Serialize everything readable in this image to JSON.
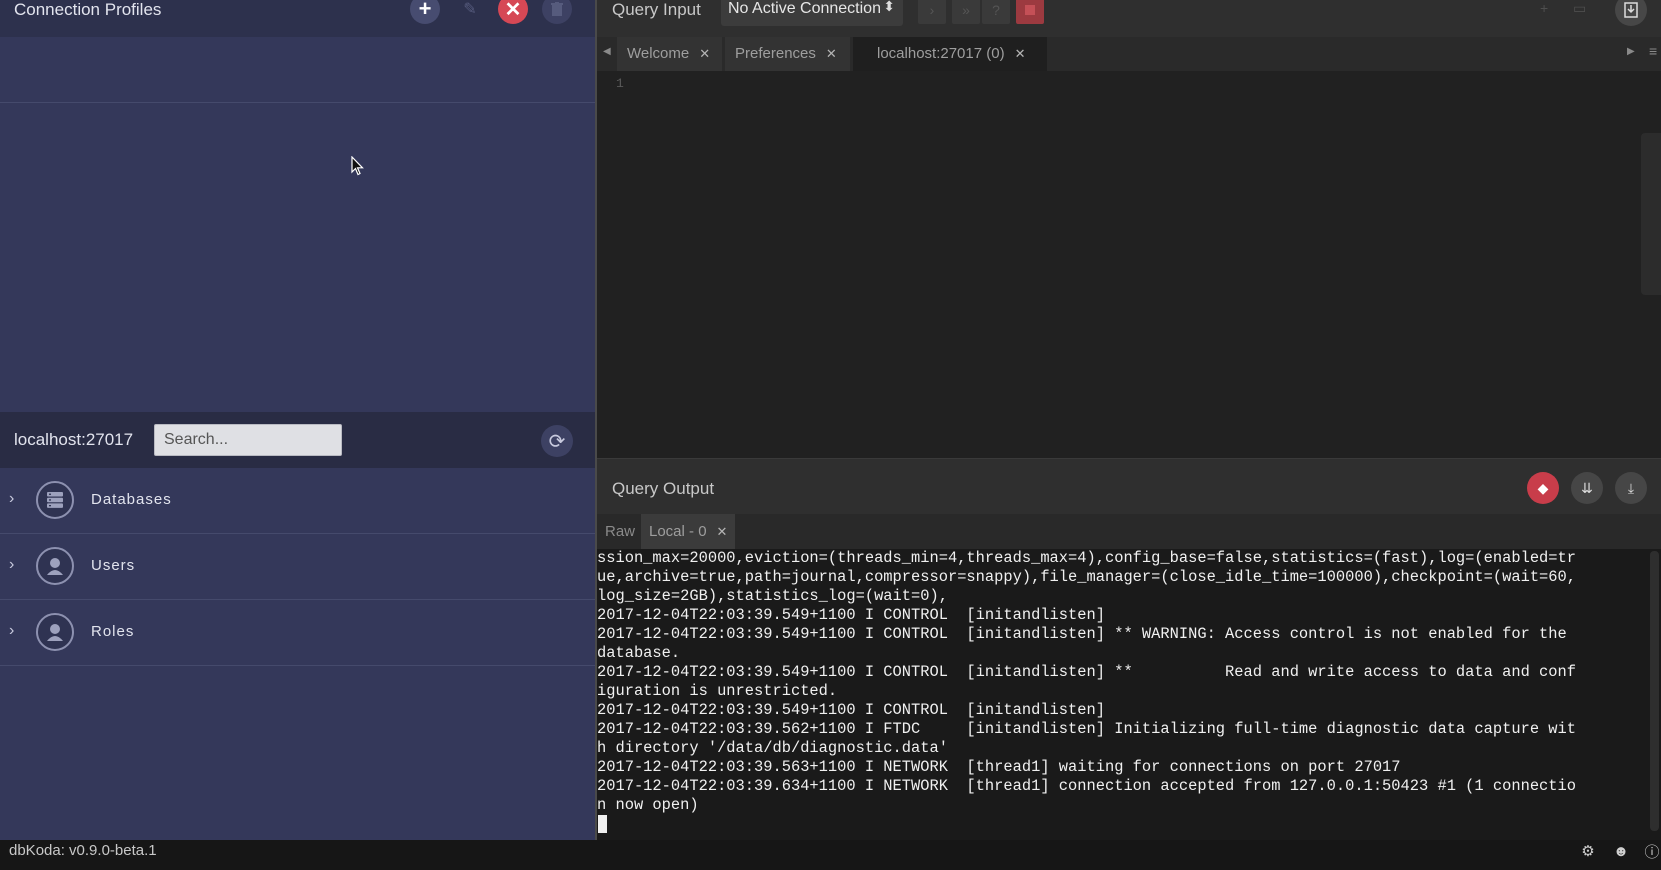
{
  "left_panel": {
    "title": "Connection Profiles",
    "toolbar": {
      "add_glyph": "+",
      "edit_glyph": "✎",
      "close_glyph": "✕",
      "trash_glyph": "🗑"
    },
    "connection_label": "localhost:27017",
    "search_placeholder": "Search...",
    "refresh_glyph": "⟳",
    "tree": [
      {
        "label": "Databases",
        "icon": "database-icon"
      },
      {
        "label": "Users",
        "icon": "user-icon"
      },
      {
        "label": "Roles",
        "icon": "roles-icon"
      }
    ]
  },
  "query_input": {
    "title": "Query Input",
    "connection_select": "No Active Connection",
    "select_arrows": "⬍",
    "tabs": [
      {
        "label": "Welcome",
        "close": "✕"
      },
      {
        "label": "Preferences",
        "close": "✕"
      },
      {
        "label": "localhost:27017 (0)",
        "close": "✕"
      }
    ],
    "line_number": "1"
  },
  "query_output": {
    "title": "Query Output",
    "tabs": [
      {
        "label": "Raw"
      },
      {
        "label": "Local - 0",
        "close": "✕"
      }
    ],
    "log": "ssion_max=20000,eviction=(threads_min=4,threads_max=4),config_base=false,statistics=(fast),log=(enabled=tr\nue,archive=true,path=journal,compressor=snappy),file_manager=(close_idle_time=100000),checkpoint=(wait=60,\nlog_size=2GB),statistics_log=(wait=0),\n2017-12-04T22:03:39.549+1100 I CONTROL  [initandlisten]\n2017-12-04T22:03:39.549+1100 I CONTROL  [initandlisten] ** WARNING: Access control is not enabled for the\ndatabase.\n2017-12-04T22:03:39.549+1100 I CONTROL  [initandlisten] **          Read and write access to data and conf\niguration is unrestricted.\n2017-12-04T22:03:39.549+1100 I CONTROL  [initandlisten]\n2017-12-04T22:03:39.562+1100 I FTDC     [initandlisten] Initializing full-time diagnostic data capture wit\nh directory '/data/db/diagnostic.data'\n2017-12-04T22:03:39.563+1100 I NETWORK  [thread1] waiting for connections on port 27017\n2017-12-04T22:03:39.634+1100 I NETWORK  [thread1] connection accepted from 127.0.0.1:50423 #1 (1 connectio\nn now open)"
  },
  "status_bar": {
    "version": "dbKoda: v0.9.0-beta.1"
  },
  "colors": {
    "accent_red": "#d64855",
    "left_panel_bg": "#34385a"
  }
}
